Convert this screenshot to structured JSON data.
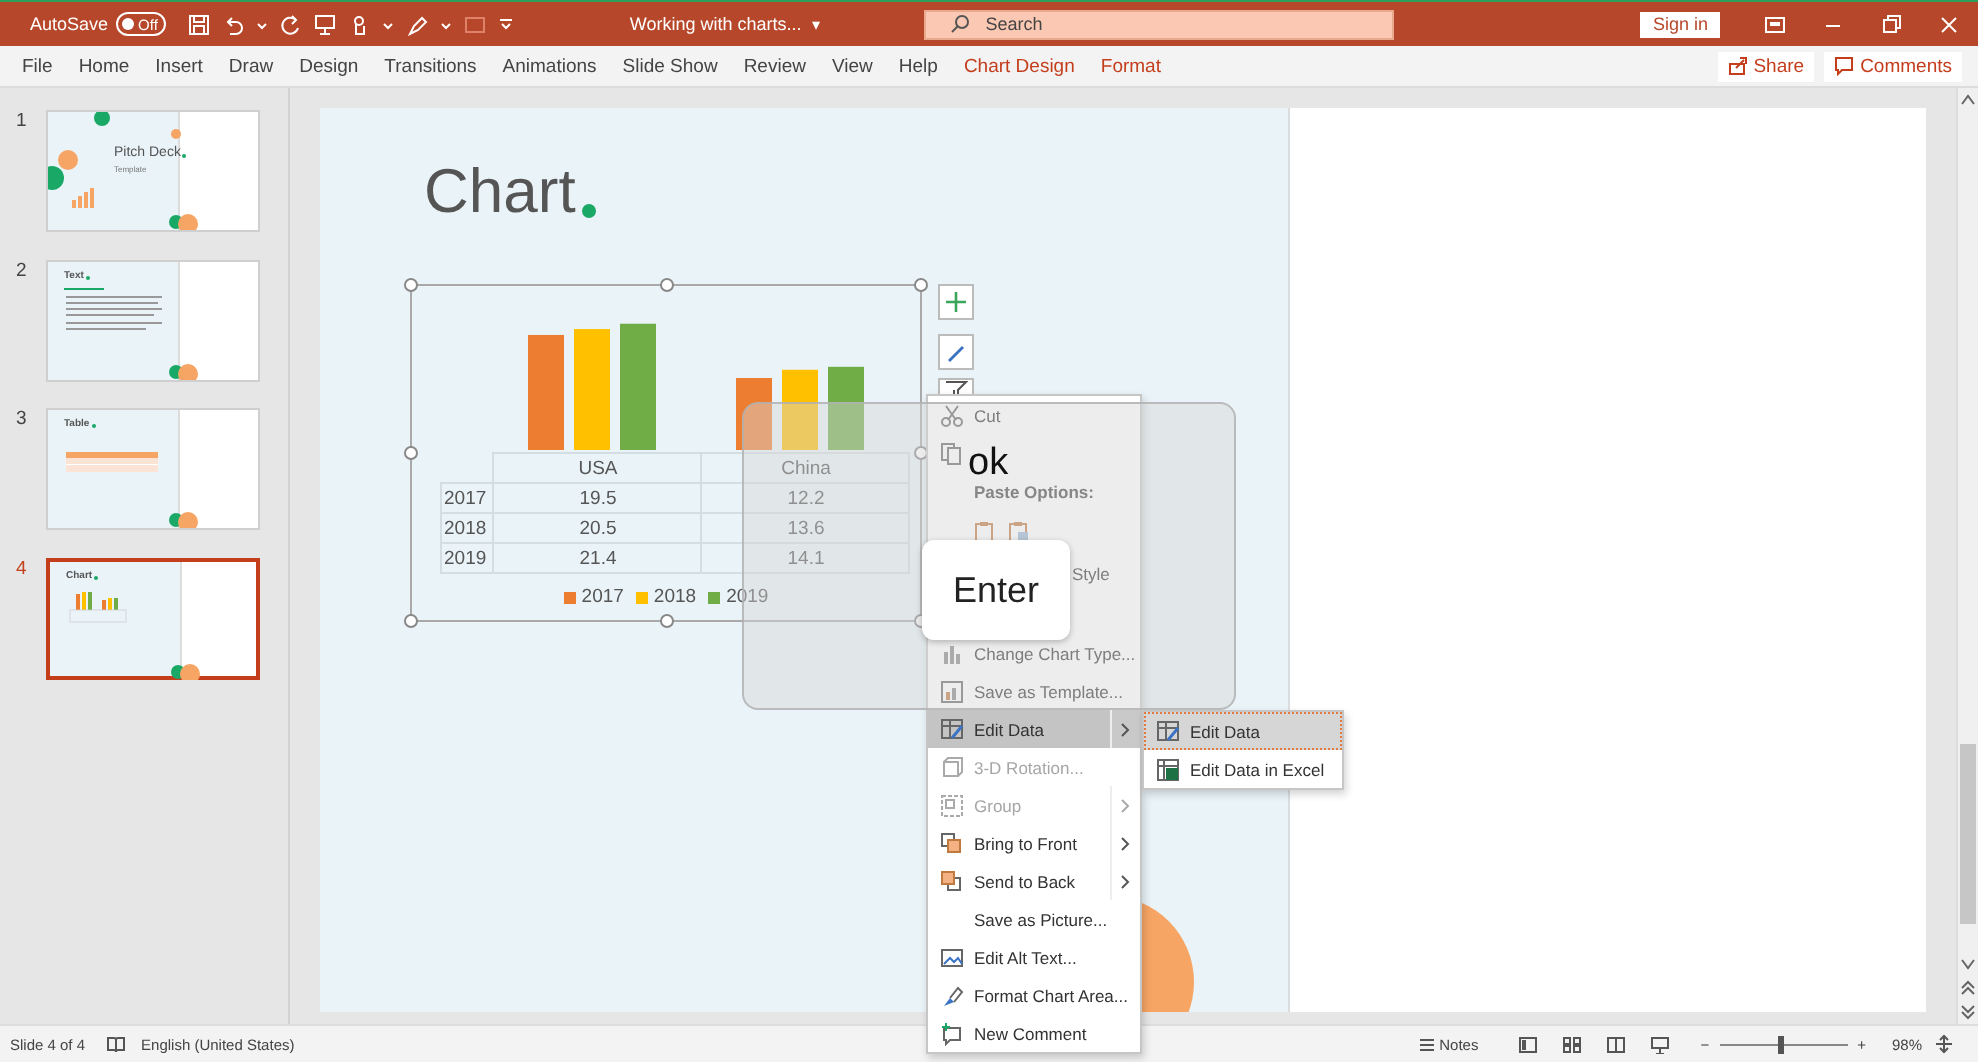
{
  "title_bar": {
    "autosave": {
      "label": "AutoSave",
      "on": false,
      "state": "Off"
    },
    "document_title": "Working with charts...",
    "title_caret": "▾",
    "search": {
      "placeholder": "Search"
    },
    "sign_in": "Sign in"
  },
  "ribbon_tabs": [
    {
      "label": "File",
      "kind": "standard"
    },
    {
      "label": "Home",
      "kind": "standard"
    },
    {
      "label": "Insert",
      "kind": "standard"
    },
    {
      "label": "Draw",
      "kind": "standard"
    },
    {
      "label": "Design",
      "kind": "standard"
    },
    {
      "label": "Transitions",
      "kind": "standard"
    },
    {
      "label": "Animations",
      "kind": "standard"
    },
    {
      "label": "Slide Show",
      "kind": "standard"
    },
    {
      "label": "Review",
      "kind": "standard"
    },
    {
      "label": "View",
      "kind": "standard"
    },
    {
      "label": "Help",
      "kind": "standard"
    },
    {
      "label": "Chart Design",
      "kind": "contextual"
    },
    {
      "label": "Format",
      "kind": "contextual"
    }
  ],
  "ribbon_buttons": [
    {
      "label": "Share",
      "kind": "share"
    },
    {
      "label": "Comments",
      "kind": "comments"
    }
  ],
  "slide_thumbnails": [
    {
      "number": "1",
      "kind": "title",
      "title": "Pitch Deck",
      "subtitle": "Template",
      "selected": false
    },
    {
      "number": "2",
      "kind": "text",
      "title": "Text",
      "selected": false
    },
    {
      "number": "3",
      "kind": "table",
      "title": "Table",
      "selected": false
    },
    {
      "number": "4",
      "kind": "chart",
      "title": "Chart",
      "selected": true
    }
  ],
  "slide": {
    "title": "Chart",
    "chart": {
      "chart_data": {
        "type": "bar",
        "categories": [
          "USA",
          "China"
        ],
        "series": [
          {
            "name": "2017",
            "color": "#ed7d31",
            "values": [
              19.5,
              12.2
            ]
          },
          {
            "name": "2018",
            "color": "#ffc000",
            "values": [
              20.5,
              13.6
            ]
          },
          {
            "name": "2019",
            "color": "#70ad47",
            "values": [
              21.4,
              14.1
            ]
          }
        ],
        "data_labels": true,
        "legend": "bottom"
      }
    }
  },
  "context_menu": [
    {
      "label": "Cut",
      "kind": "item",
      "disabled": false,
      "submenu": false,
      "highlighted": false
    },
    {
      "kind": "covered"
    },
    {
      "label": "Paste Options:",
      "kind": "header"
    },
    {
      "kind": "paste-options"
    },
    {
      "label": "Style",
      "kind": "partial"
    },
    {
      "label": "Change Chart Type...",
      "kind": "item",
      "disabled": false,
      "submenu": false,
      "highlighted": false
    },
    {
      "label": "Save as Template...",
      "kind": "item",
      "disabled": false,
      "submenu": false,
      "highlighted": false
    },
    {
      "label": "Edit Data",
      "kind": "item",
      "disabled": false,
      "submenu": true,
      "highlighted": true
    },
    {
      "label": "3-D Rotation...",
      "kind": "item",
      "disabled": true,
      "submenu": false,
      "highlighted": false
    },
    {
      "label": "Group",
      "kind": "item",
      "disabled": true,
      "submenu": true,
      "highlighted": false
    },
    {
      "label": "Bring to Front",
      "kind": "item",
      "disabled": false,
      "submenu": true,
      "highlighted": false
    },
    {
      "label": "Send to Back",
      "kind": "item",
      "disabled": false,
      "submenu": true,
      "highlighted": false
    },
    {
      "label": "Save as Picture...",
      "kind": "item",
      "disabled": false,
      "submenu": false,
      "highlighted": false
    },
    {
      "label": "Edit Alt Text...",
      "kind": "item",
      "disabled": false,
      "submenu": false,
      "highlighted": false
    },
    {
      "label": "Format Chart Area...",
      "kind": "item",
      "disabled": false,
      "submenu": false,
      "highlighted": false
    },
    {
      "label": "New Comment",
      "kind": "item",
      "disabled": false,
      "submenu": false,
      "highlighted": false
    }
  ],
  "submenu": [
    {
      "label": "Edit Data",
      "highlighted": true
    },
    {
      "label": "Edit Data in Excel",
      "highlighted": false
    }
  ],
  "key_overlay": {
    "text": "ok",
    "key": "Enter"
  },
  "status_bar": {
    "slide_info": "Slide 4 of 4",
    "language": "English (United States)",
    "notes": "Notes",
    "zoom": {
      "minus": "−",
      "level": 0.47,
      "plus": "+",
      "reading": "98%"
    }
  }
}
